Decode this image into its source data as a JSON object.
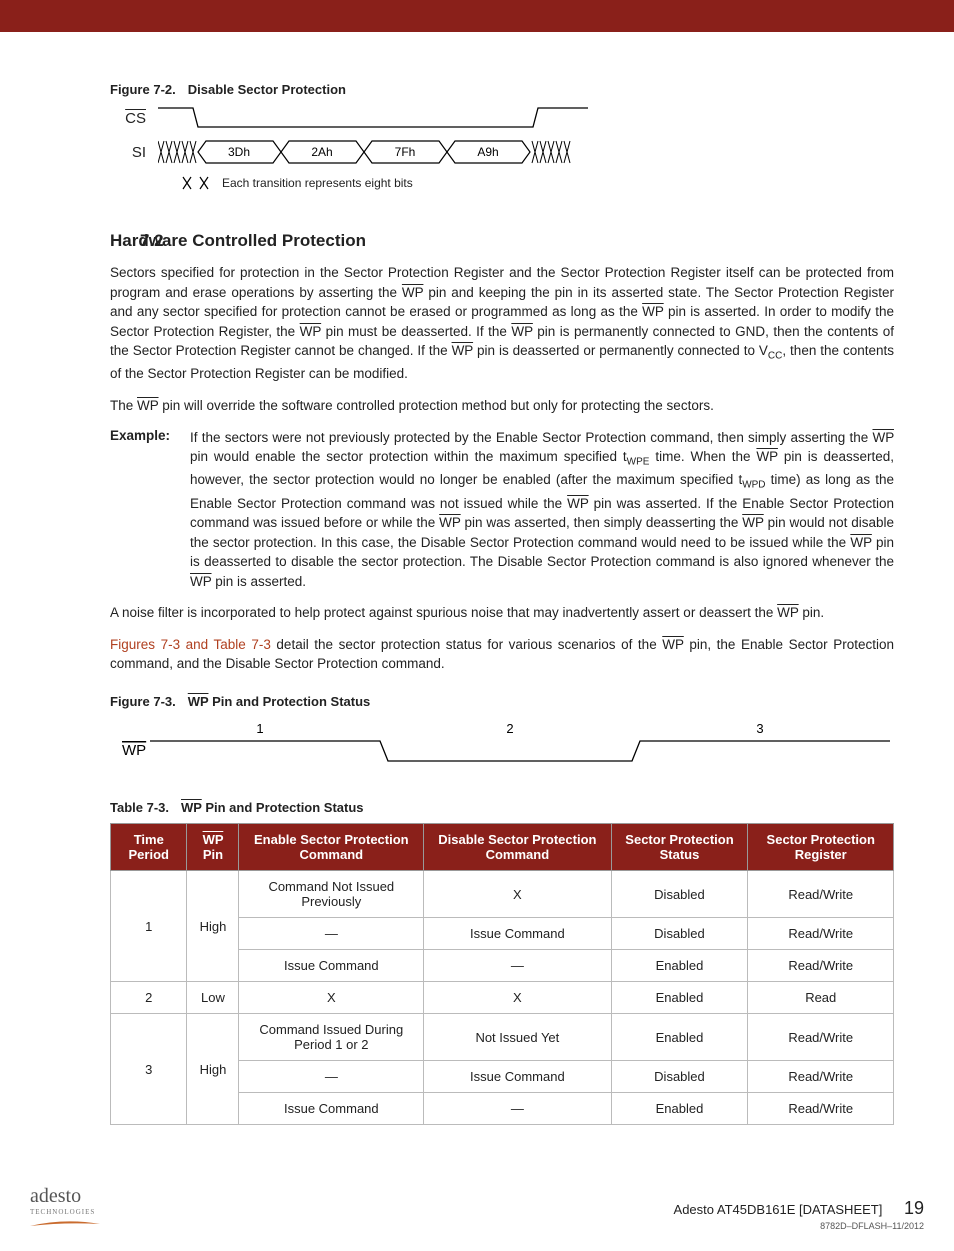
{
  "figure72": {
    "caption_num": "Figure 7-2.",
    "caption_text": "Disable Sector Protection",
    "cs_label": "CS",
    "si_label": "SI",
    "bytes": [
      "3Dh",
      "2Ah",
      "7Fh",
      "A9h"
    ],
    "note": "Each transition represents eight bits"
  },
  "section": {
    "number": "7.2",
    "title": "Hardware Controlled Protection"
  },
  "para1a": "Sectors specified for protection in the Sector Protection Register and the Sector Protection Register itself can be protected from program and erase operations by asserting the ",
  "para1b": " pin and keeping the pin in its asserted state. The Sector Protection Register and any sector specified for protection cannot be erased or programmed as long as the ",
  "para1c": " pin is asserted. In order to modify the Sector Protection Register, the ",
  "para1d": " pin must be deasserted. If the ",
  "para1e": " pin is permanently connected to GND, then the contents of the Sector Protection Register cannot be changed. If the ",
  "para1f": " pin is deasserted or permanently connected to V",
  "para1g": ", then the contents of the Sector Protection Register can be modified.",
  "para2a": "The ",
  "para2b": " pin will override the software controlled protection method but only for protecting the sectors.",
  "example_label": "Example:",
  "example_a": "If the sectors were not previously protected by the Enable Sector Protection command, then simply asserting the ",
  "example_b": " pin would enable the sector protection within the maximum specified t",
  "example_c": " time. When the ",
  "example_d": " pin is deasserted, however, the sector protection would no longer be enabled (after the maximum specified t",
  "example_e": " time) as long as the Enable Sector Protection command was not issued while the ",
  "example_f": " pin was asserted. If the Enable Sector Protection command was issued before or while the ",
  "example_g": " pin was asserted, then simply deasserting the ",
  "example_h": " pin would not disable the sector protection. In this case, the Disable Sector Protection command would need to be issued while the ",
  "example_i": " pin is deasserted to disable the sector protection. The Disable Sector Protection command is also ignored whenever the ",
  "example_j": " pin is asserted.",
  "para3a": "A noise filter is incorporated to help protect against spurious noise that may inadvertently assert or deassert the ",
  "para3b": " pin.",
  "para4_link": "Figures 7-3 and Table 7-3",
  "para4a": " detail the sector protection status for various scenarios of the ",
  "para4b": " pin, the Enable Sector Protection command, and the Disable Sector Protection command.",
  "figure73": {
    "caption_num": "Figure 7-3.",
    "caption_text": " Pin and Protection Status",
    "wp_label": "WP",
    "periods": [
      "1",
      "2",
      "3"
    ]
  },
  "table73": {
    "caption_num": "Table 7-3.",
    "caption_text": " Pin and Protection Status",
    "headers": [
      "Time Period",
      " Pin",
      "Enable Sector Protection Command",
      "Disable Sector Protection Command",
      "Sector Protection Status",
      "Sector Protection Register"
    ],
    "wp_header_prefix": "WP",
    "rows": [
      {
        "period": "1",
        "rowspan": 3,
        "wp": "High",
        "wpspan": 3,
        "c1": "Command Not Issued Previously",
        "c2": "X",
        "c3": "Disabled",
        "c4": "Read/Write"
      },
      {
        "c1": "—",
        "c2": "Issue Command",
        "c3": "Disabled",
        "c4": "Read/Write"
      },
      {
        "c1": "Issue Command",
        "c2": "—",
        "c3": "Enabled",
        "c4": "Read/Write"
      },
      {
        "period": "2",
        "rowspan": 1,
        "wp": "Low",
        "wpspan": 1,
        "c1": "X",
        "c2": "X",
        "c3": "Enabled",
        "c4": "Read"
      },
      {
        "period": "3",
        "rowspan": 3,
        "wp": "High",
        "wpspan": 3,
        "c1": "Command Issued During Period 1 or 2",
        "c2": "Not Issued Yet",
        "c3": "Enabled",
        "c4": "Read/Write"
      },
      {
        "c1": "—",
        "c2": "Issue Command",
        "c3": "Disabled",
        "c4": "Read/Write"
      },
      {
        "c1": "Issue Command",
        "c2": "—",
        "c3": "Enabled",
        "c4": "Read/Write"
      }
    ]
  },
  "footer": {
    "logo_main": "adesto",
    "logo_sub": "TECHNOLOGIES",
    "title": "Adesto AT45DB161E [DATASHEET]",
    "docnum": "8782D–DFLASH–11/2012",
    "page": "19"
  },
  "wp": "WP",
  "vcc_sub": "CC",
  "twpe_sub": "WPE",
  "twpd_sub": "WPD"
}
